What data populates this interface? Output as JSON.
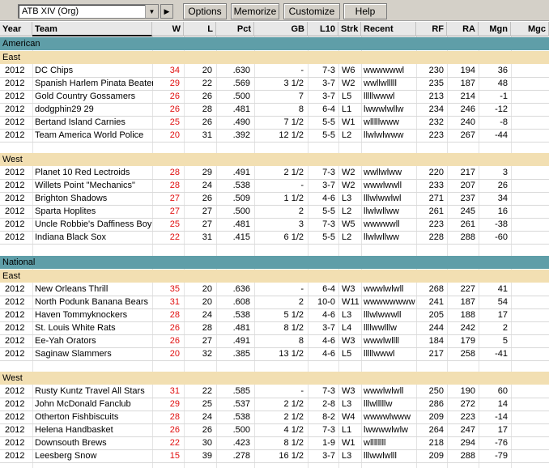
{
  "toolbar": {
    "selector_value": "ATB XIV (Org)",
    "options_label": "Options",
    "memorize_label": "Memorize",
    "customize_label": "Customize",
    "help_label": "Help"
  },
  "columns": {
    "year": "Year",
    "team": "Team",
    "w": "W",
    "l": "L",
    "pct": "Pct",
    "gb": "GB",
    "l10": "L10",
    "strk": "Strk",
    "recent": "Recent",
    "rf": "RF",
    "ra": "RA",
    "mgn": "Mgn",
    "mgc": "Mgc"
  },
  "colors": {
    "league_bg": "#5f9ea8",
    "division_bg": "#f2dfb2",
    "wins_red": "#e01010"
  },
  "leagues": [
    {
      "name": "American",
      "divisions": [
        {
          "name": "East",
          "teams": [
            {
              "year": "2012",
              "team": "DC Chips",
              "w": "34",
              "l": "20",
              "pct": ".630",
              "gb": "-",
              "l10": "7-3",
              "strk": "W6",
              "recent": "wwwwwwl",
              "rf": "230",
              "ra": "194",
              "mgn": "36",
              "mgc": ""
            },
            {
              "year": "2012",
              "team": "Spanish Harlem Pinata Beater",
              "w": "29",
              "l": "22",
              "pct": ".569",
              "gb": "3 1/2",
              "l10": "3-7",
              "strk": "W2",
              "recent": "wwllwlllll",
              "rf": "235",
              "ra": "187",
              "mgn": "48",
              "mgc": ""
            },
            {
              "year": "2012",
              "team": "Gold Country Gossamers",
              "w": "26",
              "l": "26",
              "pct": ".500",
              "gb": "7",
              "l10": "3-7",
              "strk": "L5",
              "recent": "lllllwwwl",
              "rf": "213",
              "ra": "214",
              "mgn": "-1",
              "mgc": ""
            },
            {
              "year": "2012",
              "team": "dodgphin29 29",
              "w": "26",
              "l": "28",
              "pct": ".481",
              "gb": "8",
              "l10": "6-4",
              "strk": "L1",
              "recent": "lwwwlwllw",
              "rf": "234",
              "ra": "246",
              "mgn": "-12",
              "mgc": ""
            },
            {
              "year": "2012",
              "team": "Bertand Island Carnies",
              "w": "25",
              "l": "26",
              "pct": ".490",
              "gb": "7 1/2",
              "l10": "5-5",
              "strk": "W1",
              "recent": "wlllllwww",
              "rf": "232",
              "ra": "240",
              "mgn": "-8",
              "mgc": ""
            },
            {
              "year": "2012",
              "team": "Team America World Police",
              "w": "20",
              "l": "31",
              "pct": ".392",
              "gb": "12 1/2",
              "l10": "5-5",
              "strk": "L2",
              "recent": "llwlwlwww",
              "rf": "223",
              "ra": "267",
              "mgn": "-44",
              "mgc": ""
            }
          ]
        },
        {
          "name": "West",
          "teams": [
            {
              "year": "2012",
              "team": "Planet 10 Red Lectroids",
              "w": "28",
              "l": "29",
              "pct": ".491",
              "gb": "2 1/2",
              "l10": "7-3",
              "strk": "W2",
              "recent": "wwllwlww",
              "rf": "220",
              "ra": "217",
              "mgn": "3",
              "mgc": ""
            },
            {
              "year": "2012",
              "team": "Willets Point \"Mechanics\"",
              "w": "28",
              "l": "24",
              "pct": ".538",
              "gb": "-",
              "l10": "3-7",
              "strk": "W2",
              "recent": "wwwlwwll",
              "rf": "233",
              "ra": "207",
              "mgn": "26",
              "mgc": ""
            },
            {
              "year": "2012",
              "team": "Brighton Shadows",
              "w": "27",
              "l": "26",
              "pct": ".509",
              "gb": "1 1/2",
              "l10": "4-6",
              "strk": "L3",
              "recent": "lllwlwwlwl",
              "rf": "271",
              "ra": "237",
              "mgn": "34",
              "mgc": ""
            },
            {
              "year": "2012",
              "team": "Sparta Hoplites",
              "w": "27",
              "l": "27",
              "pct": ".500",
              "gb": "2",
              "l10": "5-5",
              "strk": "L2",
              "recent": "llwlwllww",
              "rf": "261",
              "ra": "245",
              "mgn": "16",
              "mgc": ""
            },
            {
              "year": "2012",
              "team": "Uncle Robbie's Daffiness Boy",
              "w": "25",
              "l": "27",
              "pct": ".481",
              "gb": "3",
              "l10": "7-3",
              "strk": "W5",
              "recent": "wwwwwll",
              "rf": "223",
              "ra": "261",
              "mgn": "-38",
              "mgc": ""
            },
            {
              "year": "2012",
              "team": "Indiana Black Sox",
              "w": "22",
              "l": "31",
              "pct": ".415",
              "gb": "6 1/2",
              "l10": "5-5",
              "strk": "L2",
              "recent": "llwlwllww",
              "rf": "228",
              "ra": "288",
              "mgn": "-60",
              "mgc": ""
            }
          ]
        }
      ]
    },
    {
      "name": "National",
      "divisions": [
        {
          "name": "East",
          "teams": [
            {
              "year": "2012",
              "team": "New Orleans Thrill",
              "w": "35",
              "l": "20",
              "pct": ".636",
              "gb": "-",
              "l10": "6-4",
              "strk": "W3",
              "recent": "wwwlwlwll",
              "rf": "268",
              "ra": "227",
              "mgn": "41",
              "mgc": ""
            },
            {
              "year": "2012",
              "team": "North Podunk Banana Bears",
              "w": "31",
              "l": "20",
              "pct": ".608",
              "gb": "2",
              "l10": "10-0",
              "strk": "W11",
              "recent": "wwwwwwww",
              "rf": "241",
              "ra": "187",
              "mgn": "54",
              "mgc": ""
            },
            {
              "year": "2012",
              "team": "Haven Tommyknockers",
              "w": "28",
              "l": "24",
              "pct": ".538",
              "gb": "5 1/2",
              "l10": "4-6",
              "strk": "L3",
              "recent": "lllwlwwwll",
              "rf": "205",
              "ra": "188",
              "mgn": "17",
              "mgc": ""
            },
            {
              "year": "2012",
              "team": "St. Louis White Rats",
              "w": "26",
              "l": "28",
              "pct": ".481",
              "gb": "8 1/2",
              "l10": "3-7",
              "strk": "L4",
              "recent": "llllwwlllw",
              "rf": "244",
              "ra": "242",
              "mgn": "2",
              "mgc": ""
            },
            {
              "year": "2012",
              "team": "Ee-Yah Orators",
              "w": "26",
              "l": "27",
              "pct": ".491",
              "gb": "8",
              "l10": "4-6",
              "strk": "W3",
              "recent": "wwwlwllll",
              "rf": "184",
              "ra": "179",
              "mgn": "5",
              "mgc": ""
            },
            {
              "year": "2012",
              "team": "Saginaw Slammers",
              "w": "20",
              "l": "32",
              "pct": ".385",
              "gb": "13 1/2",
              "l10": "4-6",
              "strk": "L5",
              "recent": "lllllwwwl",
              "rf": "217",
              "ra": "258",
              "mgn": "-41",
              "mgc": ""
            }
          ]
        },
        {
          "name": "West",
          "teams": [
            {
              "year": "2012",
              "team": "Rusty Kuntz Travel All Stars",
              "w": "31",
              "l": "22",
              "pct": ".585",
              "gb": "-",
              "l10": "7-3",
              "strk": "W3",
              "recent": "wwwlwlwll",
              "rf": "250",
              "ra": "190",
              "mgn": "60",
              "mgc": ""
            },
            {
              "year": "2012",
              "team": "John McDonald Fanclub",
              "w": "29",
              "l": "25",
              "pct": ".537",
              "gb": "2 1/2",
              "l10": "2-8",
              "strk": "L3",
              "recent": "lllwlllllw",
              "rf": "286",
              "ra": "272",
              "mgn": "14",
              "mgc": ""
            },
            {
              "year": "2012",
              "team": "Otherton Fishbiscuits",
              "w": "28",
              "l": "24",
              "pct": ".538",
              "gb": "2 1/2",
              "l10": "8-2",
              "strk": "W4",
              "recent": "wwwwlwww",
              "rf": "209",
              "ra": "223",
              "mgn": "-14",
              "mgc": ""
            },
            {
              "year": "2012",
              "team": "Helena Handbasket",
              "w": "26",
              "l": "26",
              "pct": ".500",
              "gb": "4 1/2",
              "l10": "7-3",
              "strk": "L1",
              "recent": "lwwwwlwlw",
              "rf": "264",
              "ra": "247",
              "mgn": "17",
              "mgc": ""
            },
            {
              "year": "2012",
              "team": "Downsouth Brews",
              "w": "22",
              "l": "30",
              "pct": ".423",
              "gb": "8 1/2",
              "l10": "1-9",
              "strk": "W1",
              "recent": "wllllllll",
              "rf": "218",
              "ra": "294",
              "mgn": "-76",
              "mgc": ""
            },
            {
              "year": "2012",
              "team": "Leesberg Snow",
              "w": "15",
              "l": "39",
              "pct": ".278",
              "gb": "16 1/2",
              "l10": "3-7",
              "strk": "L3",
              "recent": "lllwwlwlll",
              "rf": "209",
              "ra": "288",
              "mgn": "-79",
              "mgc": ""
            }
          ]
        }
      ]
    }
  ]
}
